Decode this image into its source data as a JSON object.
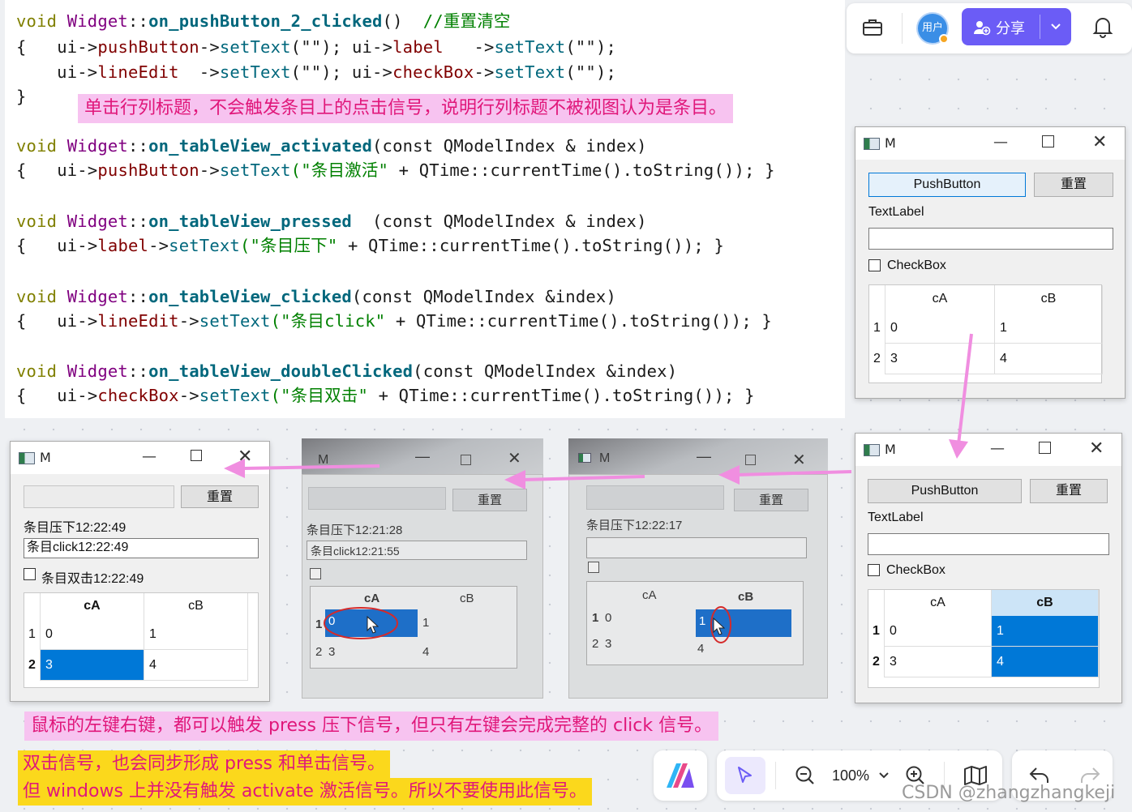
{
  "code": {
    "line1": {
      "void": "void",
      "cls": "Widget",
      "sep": "::",
      "fn": "on_pushButton_2_clicked",
      "tail": "() ",
      "comment": "//重置清空"
    },
    "line2": {
      "open": "{",
      "a": "ui->",
      "pb": "pushButton",
      "b": "->",
      "m1": "setText",
      "c": "(\"\"); ",
      "d": "ui->",
      "lb": "label",
      "e": "   ->",
      "m2": "setText",
      "f": "(\"\");"
    },
    "line3": {
      "a": "ui->",
      "le": "lineEdit",
      "b": "  ->",
      "m1": "setText",
      "c": "(\"\"); ",
      "d": "ui->",
      "cb": "checkBox",
      "e": "->",
      "m2": "setText",
      "f": "(\"\");"
    },
    "line4": {
      "close": "}"
    },
    "activated": {
      "void": "void",
      "cls": "Widget",
      "sep": "::",
      "fn": "on_tableView_activated",
      "params": "(const QModelIndex & index)"
    },
    "activated_body": {
      "open": "{",
      "a": "ui->",
      "obj": "pushButton",
      "b": "->",
      "m": "setText",
      "s": "(\"条目激活\"",
      "rest": " + QTime::currentTime().toString()); }"
    },
    "pressed": {
      "void": "void",
      "cls": "Widget",
      "sep": "::",
      "fn": "on_tableView_pressed",
      "params": "  (const QModelIndex & index)"
    },
    "pressed_body": {
      "open": "{",
      "a": "ui->",
      "obj": "label",
      "b": "->",
      "m": "setText",
      "s": "(\"条目压下\"",
      "rest": " + QTime::currentTime().toString()); }"
    },
    "clicked": {
      "void": "void",
      "cls": "Widget",
      "sep": "::",
      "fn": "on_tableView_clicked",
      "params": "(const QModelIndex &index)"
    },
    "clicked_body": {
      "open": "{",
      "a": "ui->",
      "obj": "lineEdit",
      "b": "->",
      "m": "setText",
      "s": "(\"条目click\"",
      "rest": " + QTime::currentTime().toString()); }"
    },
    "dbl": {
      "void": "void",
      "cls": "Widget",
      "sep": "::",
      "fn": "on_tableView_doubleClicked",
      "params": "(const QModelIndex &index)"
    },
    "dbl_body": {
      "open": "{",
      "a": "ui->",
      "obj": "checkBox",
      "b": "->",
      "m": "setText",
      "s": "(\"条目双击\"",
      "rest": " + QTime::currentTime().toString()); }"
    }
  },
  "notes": {
    "header_note": "单击行列标题，不会触发条目上的点击信号，说明行列标题不被视图认为是条目。",
    "press_note": "鼠标的左键右键，都可以触发 press 压下信号，但只有左键会完成完整的 click 信号。",
    "dbl_note": "双击信号，也会同步形成 press 和单击信号。",
    "activate_note": "但 windows 上并没有触发 activate 激活信号。所以不要使用此信号。"
  },
  "toolbar": {
    "avatar_text": "用户",
    "share_label": "分享",
    "icons": [
      "briefcase-icon",
      "user-add-icon",
      "chevron-down-icon",
      "bell-icon"
    ]
  },
  "win_initial": {
    "title": "M",
    "push_button": "PushButton",
    "reset_button": "重置",
    "text_label": "TextLabel",
    "line_edit": "",
    "checkbox": "CheckBox",
    "headers": [
      "cA",
      "cB"
    ],
    "rows": [
      {
        "h": "1",
        "cells": [
          "0",
          "1"
        ]
      },
      {
        "h": "2",
        "cells": [
          "3",
          "4"
        ]
      }
    ]
  },
  "win_colsel": {
    "title": "M",
    "push_button": "PushButton",
    "reset_button": "重置",
    "text_label": "TextLabel",
    "line_edit": "",
    "checkbox": "CheckBox",
    "headers": [
      "cA",
      "cB"
    ],
    "rows": [
      {
        "h": "1",
        "cells": [
          "0",
          "1"
        ]
      },
      {
        "h": "2",
        "cells": [
          "3",
          "4"
        ]
      }
    ]
  },
  "win_result": {
    "title": "M",
    "push_button": "",
    "reset_button": "重置",
    "text_label": "条目压下12:22:49",
    "line_edit": "条目click12:22:49",
    "checkbox": "条目双击12:22:49",
    "headers": [
      "cA",
      "cB"
    ],
    "rows": [
      {
        "h": "1",
        "cells": [
          "0",
          "1"
        ]
      },
      {
        "h": "2",
        "cells": [
          "3",
          "4"
        ]
      }
    ]
  },
  "photo1": {
    "title": "M",
    "reset_button": "重置",
    "label": "条目压下12:21:28",
    "line_edit": "条目click12:21:55",
    "headers": [
      "cA",
      "cB"
    ],
    "rows": [
      {
        "h": "1",
        "cells": [
          "0",
          "1"
        ]
      },
      {
        "h": "2",
        "cells": [
          "3",
          "4"
        ]
      }
    ]
  },
  "photo2": {
    "title": "M",
    "reset_button": "重置",
    "label": "条目压下12:22:17",
    "headers": [
      "cA",
      "cB"
    ],
    "rows": [
      {
        "h": "1",
        "cells": [
          "0",
          "1"
        ]
      },
      {
        "h": "2",
        "cells": [
          "3",
          "4"
        ]
      }
    ]
  },
  "bottom_toolbar": {
    "zoom": "100%",
    "icons": [
      "app-logo-icon",
      "pointer-icon",
      "zoom-out-icon",
      "chevron-down-icon",
      "zoom-in-icon",
      "map-icon",
      "undo-icon",
      "redo-icon"
    ]
  },
  "watermark": "CSDN @zhangzhangkeji",
  "colors": {
    "accent": "#6b5cf6",
    "highlight_pink": "#f7c3f0",
    "highlight_yellow": "#fbd81c",
    "selection_blue": "#0078d7",
    "arrow_pink": "#f08ee0"
  }
}
